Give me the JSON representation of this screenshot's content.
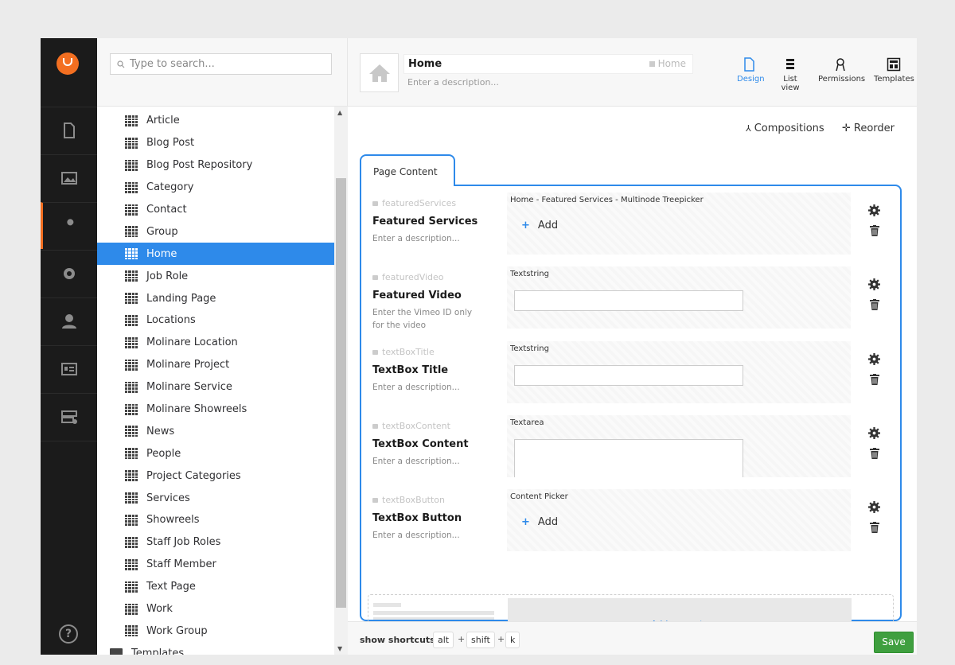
{
  "tree": {
    "search_placeholder": "Type to search...",
    "items": [
      {
        "label": "Article"
      },
      {
        "label": "Blog Post"
      },
      {
        "label": "Blog Post Repository"
      },
      {
        "label": "Category"
      },
      {
        "label": "Contact"
      },
      {
        "label": "Group"
      },
      {
        "label": "Home",
        "selected": true
      },
      {
        "label": "Job Role"
      },
      {
        "label": "Landing Page"
      },
      {
        "label": "Locations"
      },
      {
        "label": "Molinare Location"
      },
      {
        "label": "Molinare Project"
      },
      {
        "label": "Molinare Service"
      },
      {
        "label": "Molinare Showreels"
      },
      {
        "label": "News"
      },
      {
        "label": "People"
      },
      {
        "label": "Project Categories"
      },
      {
        "label": "Services"
      },
      {
        "label": "Showreels"
      },
      {
        "label": "Staff Job Roles"
      },
      {
        "label": "Staff Member"
      },
      {
        "label": "Text Page"
      },
      {
        "label": "Work"
      },
      {
        "label": "Work Group"
      }
    ],
    "folder_label": "Templates"
  },
  "header": {
    "name": "Home",
    "alias": "Home",
    "description_placeholder": "Enter a description...",
    "tools": [
      {
        "label": "Design",
        "icon": "document-icon",
        "active": true
      },
      {
        "label": "List view",
        "icon": "list-icon"
      },
      {
        "label": "Permissions",
        "icon": "permissions-icon"
      },
      {
        "label": "Templates",
        "icon": "template-icon"
      }
    ]
  },
  "actions": {
    "compositions": "Compositions",
    "reorder": "Reorder"
  },
  "tab": {
    "label": "Page Content"
  },
  "properties": [
    {
      "alias": "featuredServices",
      "label": "Featured Services",
      "description": "Enter a description...",
      "editor": "Home - Featured Services - Multinode Treepicker",
      "control": "add",
      "add_label": "Add"
    },
    {
      "alias": "featuredVideo",
      "label": "Featured Video",
      "description": "Enter the Vimeo ID only for the video",
      "editor": "Textstring",
      "control": "text"
    },
    {
      "alias": "textBoxTitle",
      "label": "TextBox Title",
      "description": "Enter a description...",
      "editor": "Textstring",
      "control": "text"
    },
    {
      "alias": "textBoxContent",
      "label": "TextBox Content",
      "description": "Enter a description...",
      "editor": "Textarea",
      "control": "area"
    },
    {
      "alias": "textBoxButton",
      "label": "TextBox Button",
      "description": "Enter a description...",
      "editor": "Content Picker",
      "control": "add",
      "add_label": "Add"
    }
  ],
  "add_property": "Add property",
  "footer": {
    "shortcuts_label": "show shortcuts",
    "keys": [
      "alt",
      "shift",
      "k"
    ],
    "plus": "+",
    "save": "Save"
  },
  "colors": {
    "accent": "#2e8aea",
    "brand": "#f36f21",
    "save": "#3f9f3f",
    "nav_bg": "#1b1b1b"
  }
}
